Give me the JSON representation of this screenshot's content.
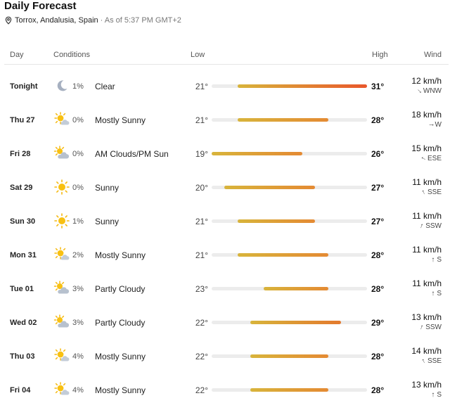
{
  "header": {
    "title": "Daily Forecast",
    "location": "Torrox, Andalusia, Spain",
    "as_of": "· As of 5:37 PM GMT+2"
  },
  "columns": {
    "day": "Day",
    "conditions": "Conditions",
    "low": "Low",
    "high": "High",
    "wind": "Wind"
  },
  "scale": {
    "min": 19,
    "max": 31
  },
  "days": [
    {
      "day": "Tonight",
      "icon": "moon",
      "precip": "1%",
      "condition": "Clear",
      "low": "21°",
      "high": "31°",
      "low_val": 21,
      "high_val": 31,
      "wind_speed": "12 km/h",
      "wind_dir": "WNW",
      "wind_rot": 135
    },
    {
      "day": "Thu 27",
      "icon": "sun-cloud",
      "precip": "0%",
      "condition": "Mostly Sunny",
      "low": "21°",
      "high": "28°",
      "low_val": 21,
      "high_val": 28,
      "wind_speed": "18 km/h",
      "wind_dir": "W",
      "wind_rot": 90
    },
    {
      "day": "Fri 28",
      "icon": "cloud-sun",
      "precip": "0%",
      "condition": "AM Clouds/PM Sun",
      "low": "19°",
      "high": "26°",
      "low_val": 19,
      "high_val": 26,
      "wind_speed": "15 km/h",
      "wind_dir": "ESE",
      "wind_rot": -60
    },
    {
      "day": "Sat 29",
      "icon": "sun",
      "precip": "0%",
      "condition": "Sunny",
      "low": "20°",
      "high": "27°",
      "low_val": 20,
      "high_val": 27,
      "wind_speed": "11 km/h",
      "wind_dir": "SSE",
      "wind_rot": -25
    },
    {
      "day": "Sun 30",
      "icon": "sun",
      "precip": "1%",
      "condition": "Sunny",
      "low": "21°",
      "high": "27°",
      "low_val": 21,
      "high_val": 27,
      "wind_speed": "11 km/h",
      "wind_dir": "SSW",
      "wind_rot": 20
    },
    {
      "day": "Mon 31",
      "icon": "sun-cloud",
      "precip": "2%",
      "condition": "Mostly Sunny",
      "low": "21°",
      "high": "28°",
      "low_val": 21,
      "high_val": 28,
      "wind_speed": "11 km/h",
      "wind_dir": "S",
      "wind_rot": 0
    },
    {
      "day": "Tue 01",
      "icon": "cloud-sun",
      "precip": "3%",
      "condition": "Partly Cloudy",
      "low": "23°",
      "high": "28°",
      "low_val": 23,
      "high_val": 28,
      "wind_speed": "11 km/h",
      "wind_dir": "S",
      "wind_rot": 0
    },
    {
      "day": "Wed 02",
      "icon": "cloud-sun",
      "precip": "3%",
      "condition": "Partly Cloudy",
      "low": "22°",
      "high": "29°",
      "low_val": 22,
      "high_val": 29,
      "wind_speed": "13 km/h",
      "wind_dir": "SSW",
      "wind_rot": 20
    },
    {
      "day": "Thu 03",
      "icon": "sun-cloud",
      "precip": "4%",
      "condition": "Mostly Sunny",
      "low": "22°",
      "high": "28°",
      "low_val": 22,
      "high_val": 28,
      "wind_speed": "14 km/h",
      "wind_dir": "SSE",
      "wind_rot": -25
    },
    {
      "day": "Fri 04",
      "icon": "sun-cloud",
      "precip": "4%",
      "condition": "Mostly Sunny",
      "low": "22°",
      "high": "28°",
      "low_val": 22,
      "high_val": 28,
      "wind_speed": "13 km/h",
      "wind_dir": "S",
      "wind_rot": 0
    }
  ]
}
